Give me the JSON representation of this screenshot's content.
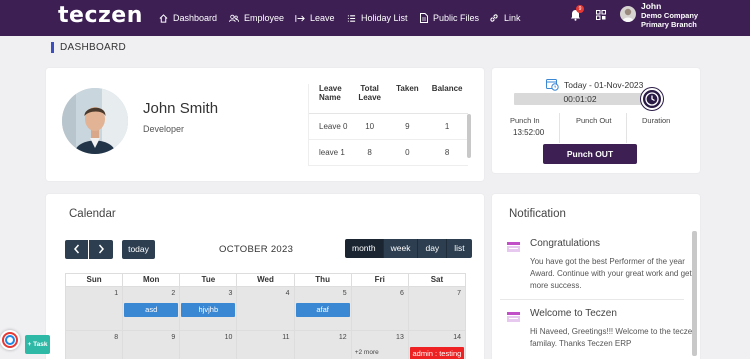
{
  "brand": {
    "logo_text": "teczen"
  },
  "nav": {
    "items": [
      {
        "label": "Dashboard",
        "icon": "home-icon"
      },
      {
        "label": "Employee",
        "icon": "users-icon"
      },
      {
        "label": "Leave",
        "icon": "leave-arrow-icon"
      },
      {
        "label": "Holiday List",
        "icon": "list-icon"
      },
      {
        "label": "Public Files",
        "icon": "file-icon"
      },
      {
        "label": "Link",
        "icon": "link-icon"
      }
    ],
    "notification_count": "9"
  },
  "user": {
    "name": "John",
    "company": "Demo Company",
    "branch": "Primary Branch"
  },
  "page": {
    "title": "DASHBOARD"
  },
  "profile": {
    "name": "John Smith",
    "role": "Developer"
  },
  "leave_table": {
    "headers": [
      "Leave Name",
      "Total Leave",
      "Taken",
      "Balance"
    ],
    "rows": [
      {
        "name": "Leave 0",
        "total": "10",
        "taken": "9",
        "balance": "1"
      },
      {
        "name": "leave 1",
        "total": "8",
        "taken": "0",
        "balance": "8"
      }
    ]
  },
  "punch": {
    "date_label": "Today - 01-Nov-2023",
    "timer": "00:01:02",
    "punch_in_label": "Punch In",
    "punch_in_value": "13:52:00",
    "punch_out_label": "Punch Out",
    "duration_label": "Duration",
    "button_label": "Punch OUT"
  },
  "calendar": {
    "title": "Calendar",
    "today_label": "today",
    "month_label": "OCTOBER 2023",
    "views": [
      "month",
      "week",
      "day",
      "list"
    ],
    "active_view": "month",
    "weekdays": [
      "Sun",
      "Mon",
      "Tue",
      "Wed",
      "Thu",
      "Fri",
      "Sat"
    ],
    "week1_days": [
      "1",
      "2",
      "3",
      "4",
      "5",
      "6",
      "7"
    ],
    "week2_days": [
      "8",
      "9",
      "10",
      "11",
      "12",
      "13",
      "14"
    ],
    "events": {
      "mon": "asd",
      "tue": "hjvjhb",
      "thu": "afaf",
      "more": "+2 more",
      "sat": "admin : testing"
    }
  },
  "notifications": {
    "title": "Notification",
    "items": [
      {
        "heading": "Congratulations",
        "body": "You have got the best Performer of the year Award. Continue with your great work and get more success."
      },
      {
        "heading": "Welcome to Teczen",
        "body": "Hi Naveed, Greetings!!! Welcome to the teczen familay. Thanks Teczen ERP"
      }
    ]
  },
  "float": {
    "task_label": "+ Task"
  },
  "colors": {
    "nav_bg": "#3d1f54",
    "event_blue": "#3a87d4",
    "event_red": "#ee2222",
    "button_dark": "#2c3e50",
    "task_green": "#2eb8a6"
  }
}
